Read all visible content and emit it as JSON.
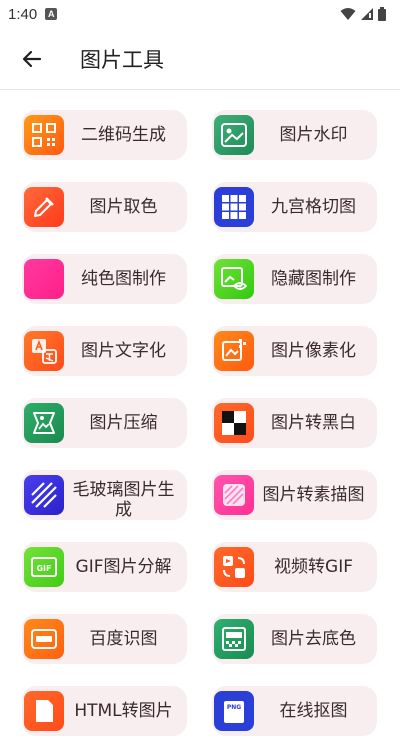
{
  "status": {
    "time": "1:40"
  },
  "appbar": {
    "title": "图片工具"
  },
  "tools": [
    {
      "label": "二维码生成",
      "icon": "qr-code-icon",
      "color": "#ff7a1a"
    },
    {
      "label": "图片水印",
      "icon": "image-watermark-icon",
      "color": "#2e9e6a"
    },
    {
      "label": "图片取色",
      "icon": "color-picker-icon",
      "color": "#ff4b2b"
    },
    {
      "label": "九宫格切图",
      "icon": "grid-nine-icon",
      "color": "#2a3fd8"
    },
    {
      "label": "纯色图制作",
      "icon": "solid-color-icon",
      "color": "#ff2f9a"
    },
    {
      "label": "隐藏图制作",
      "icon": "hidden-image-icon",
      "color": "#4cd91f"
    },
    {
      "label": "图片文字化",
      "icon": "image-to-text-icon",
      "color": "#ff5a1f"
    },
    {
      "label": "图片像素化",
      "icon": "pixelate-icon",
      "color": "#ff6a10"
    },
    {
      "label": "图片压缩",
      "icon": "compress-icon",
      "color": "#1f9e5a"
    },
    {
      "label": "图片转黑白",
      "icon": "black-white-icon",
      "color": "#ff5a20"
    },
    {
      "label": "毛玻璃图片生成",
      "icon": "frosted-glass-icon",
      "color": "#3a2ee0"
    },
    {
      "label": "图片转素描图",
      "icon": "sketch-icon",
      "color": "#ff3fa0"
    },
    {
      "label": "GIF图片分解",
      "icon": "gif-split-icon",
      "color": "#55d81a"
    },
    {
      "label": "视频转GIF",
      "icon": "video-to-gif-icon",
      "color": "#ff5a1a"
    },
    {
      "label": "百度识图",
      "icon": "image-recognition-icon",
      "color": "#ff7010"
    },
    {
      "label": "图片去底色",
      "icon": "remove-background-icon",
      "color": "#1fa060"
    },
    {
      "label": "HTML转图片",
      "icon": "html-to-image-icon",
      "color": "#ff5a1a"
    },
    {
      "label": "在线抠图",
      "icon": "online-cutout-icon",
      "color": "#2a3fd8"
    }
  ]
}
